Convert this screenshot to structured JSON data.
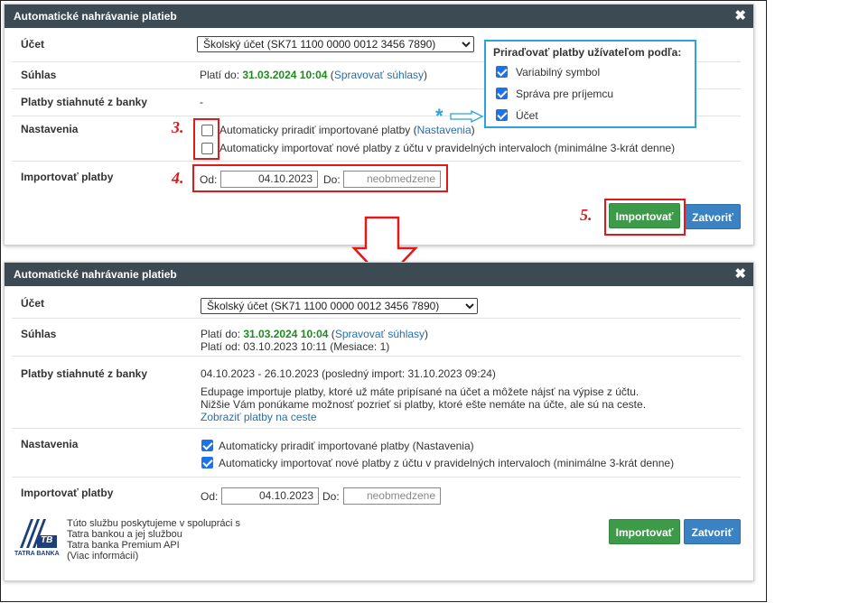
{
  "dialog1": {
    "title": "Automatické nahrávanie platieb",
    "close": "✖",
    "account_label": "Účet",
    "account_value": "Školský účet (SK71 1100 0000 0012 3456 7890)",
    "consent_label": "Súhlas",
    "valid_to_prefix": "Platí do: ",
    "valid_to_date": "31.03.2024 10:04",
    "manage_consent_open": " (",
    "manage_consent_link": "Spravovať súhlasy",
    "manage_consent_close": ")",
    "downloaded_label": "Platby stiahnuté z banky",
    "downloaded_value": "-",
    "settings_label": "Nastavenia",
    "setting1_text": "Automaticky priradiť importované platby (",
    "setting1_link": "Nastavenia",
    "setting1_end": ")",
    "setting1_checked": false,
    "setting2_text": "Automaticky importovať nové platby z účtu v pravidelných intervaloch (minimálne 3-krát denne)",
    "setting2_checked": false,
    "import_label": "Importovať platby",
    "from_label": "Od:",
    "from_value": "04.10.2023",
    "to_label": "Do:",
    "to_placeholder": "neobmedzene",
    "import_button": "Importovať",
    "close_button": "Zatvoriť"
  },
  "assign_panel": {
    "title": "Priraďovať platby užívateľom podľa:",
    "options": [
      {
        "label": "Variabilný symbol",
        "checked": true
      },
      {
        "label": "Správa pre príjemcu",
        "checked": true
      },
      {
        "label": "Účet",
        "checked": true
      }
    ]
  },
  "annotations": {
    "step3": "3.",
    "step4": "4.",
    "step5": "5.",
    "asterisk": "*"
  },
  "dialog2": {
    "title": "Automatické nahrávanie platieb",
    "close": "✖",
    "account_label": "Účet",
    "account_value": "Školský účet (SK71 1100 0000 0012 3456 7890)",
    "consent_label": "Súhlas",
    "valid_to_prefix": "Platí do: ",
    "valid_to_date": "31.03.2024 10:04",
    "manage_consent_open": " (",
    "manage_consent_link": "Spravovať súhlasy",
    "manage_consent_close": ")",
    "valid_from": "Platí od: 03.10.2023 10:11 (Mesiace: 1)",
    "downloaded_label": "Platby stiahnuté z banky",
    "downloaded_range": "04.10.2023 - 26.10.2023 (posledný import: 31.10.2023 09:24)",
    "info_line1": "Edupage importuje platby, ktoré už máte pripísané na účet a môžete nájsť na výpise z účtu.",
    "info_line2": "Nižšie Vám ponúkame možnosť pozrieť si platby, ktoré ešte nemáte na účte, ale sú na ceste.",
    "show_pending_link": "Zobraziť platby na ceste",
    "settings_label": "Nastavenia",
    "setting1_text": "Automaticky priradiť importované platby (Nastavenia)",
    "setting1_checked": true,
    "setting2_text": "Automaticky importovať nové platby z účtu v pravidelných intervaloch (minimálne 3-krát denne)",
    "setting2_checked": true,
    "import_label": "Importovať platby",
    "from_label": "Od:",
    "from_value": "04.10.2023",
    "to_label": "Do:",
    "to_placeholder": "neobmedzene",
    "partner_line1": "Túto službu poskytujeme v spolupráci s",
    "partner_line2": "Tatra bankou a jej službou",
    "partner_line3": "Tatra banka Premium API",
    "partner_line4": "(Viac informácií)",
    "logo_text": "TATRA BANKA",
    "logo_tb": "TB",
    "import_button": "Importovať",
    "close_button": "Zatvoriť"
  },
  "colors": {
    "titlebar": "#3c4a54",
    "green_button": "#3c9a48",
    "blue_button": "#3a82c4",
    "annotation_red": "#e0191b",
    "annotation_blue": "#2aa3de",
    "date_green": "#1f8a1f"
  }
}
